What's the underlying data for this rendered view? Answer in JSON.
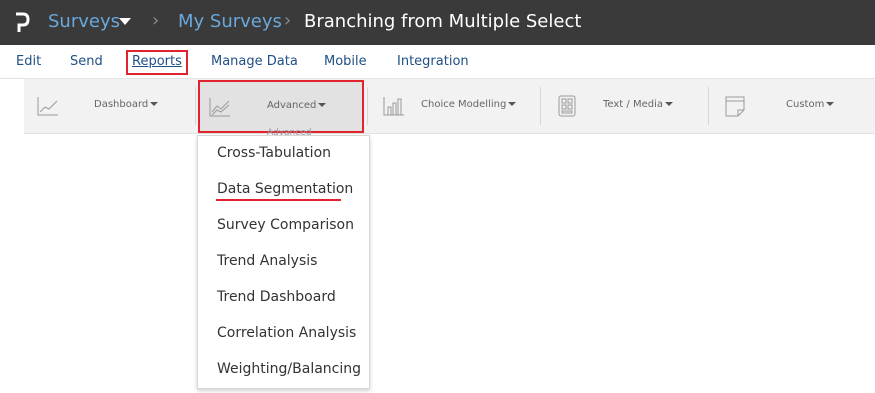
{
  "header": {
    "logo_icon": "p-logo-icon",
    "app_menu_label": "Surveys",
    "separator": "›",
    "breadcrumb_parent": "My Surveys",
    "breadcrumb_current": "Branching from Multiple Select"
  },
  "menu": {
    "edit": "Edit",
    "send": "Send",
    "reports": "Reports",
    "manage_data": "Manage Data",
    "mobile": "Mobile",
    "integration": "Integration"
  },
  "toolbar": {
    "groups": [
      {
        "label": "Dashboard",
        "icon": "line-chart-icon"
      },
      {
        "label": "Advanced",
        "icon": "multi-line-chart-icon"
      },
      {
        "label": "Choice Modelling",
        "icon": "bar-chart-icon"
      },
      {
        "label": "Text / Media",
        "icon": "text-media-icon"
      },
      {
        "label": "Custom",
        "icon": "custom-report-icon"
      }
    ]
  },
  "advanced_menu": {
    "items": [
      "Cross-Tabulation",
      "Data Segmentation",
      "Survey Comparison",
      "Trend Analysis",
      "Trend Dashboard",
      "Correlation Analysis",
      "Weighting/Balancing"
    ]
  },
  "colors": {
    "topbar": "#3a3a3a",
    "link": "#6aa8dc",
    "menu_text": "#1f4f86",
    "highlight": "#e0232d"
  }
}
